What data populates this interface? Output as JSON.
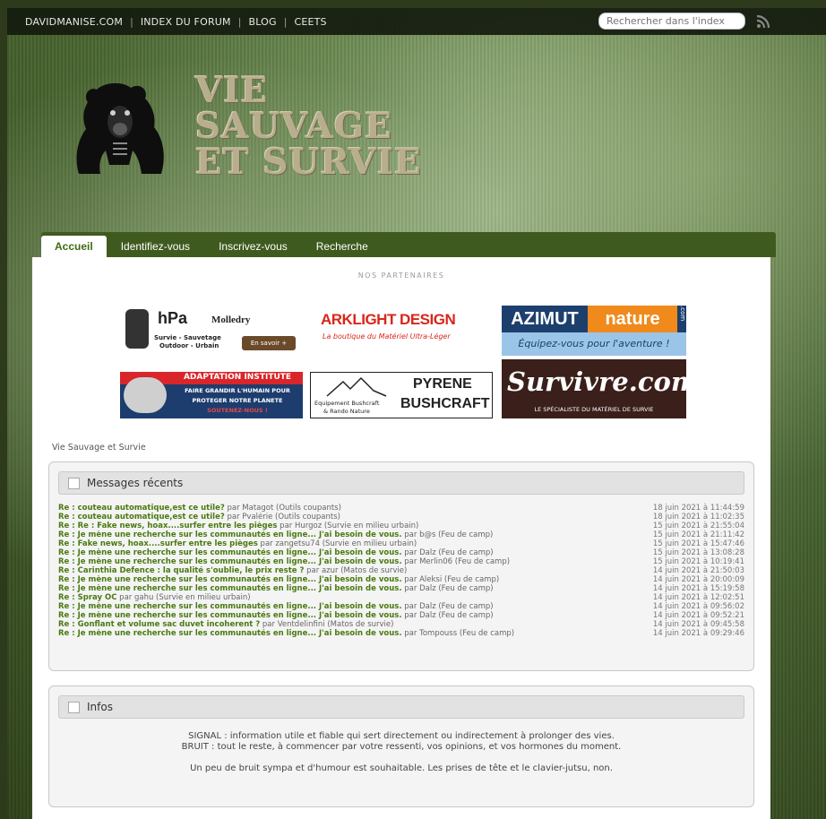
{
  "topbar": {
    "links": [
      "DAVIDMANISE.COM",
      "INDEX DU FORUM",
      "BLOG",
      "CEETS"
    ],
    "search_placeholder": "Rechercher dans l'index"
  },
  "logo": {
    "lines": [
      "VIE",
      "SAUVAGE",
      "ET SURVIE"
    ]
  },
  "nav": {
    "tabs": [
      "Accueil",
      "Identifiez-vous",
      "Inscrivez-vous",
      "Recherche"
    ]
  },
  "partners": {
    "title": "NOS PARTENAIRES",
    "hpa": {
      "name": "hPa",
      "brand2": "Molledry",
      "tag": "Survie - Sauvetage",
      "tag2": "Outdoor - Urbain",
      "btn": "En savoir +"
    },
    "arklight": {
      "name": "ARKLIGHT DESIGN",
      "tag": "La boutique du Matériel Ultra-Léger"
    },
    "azimut": {
      "name1": "AZIMUT",
      "name2": "nature",
      "dot": ".com",
      "tag": "Équipez-vous pour l'aventure !"
    },
    "adaptation": {
      "name": "ADAPTATION INSTITUTE",
      "line1": "FAIRE GRANDIR L'HUMAIN POUR",
      "line2": "PROTEGER NOTRE PLANETE",
      "line3": "SOUTENEZ-NOUS !"
    },
    "pyrene": {
      "name1": "PYRENE",
      "name2": "BUSHCRAFT",
      "tag1": "Equipement Bushcraft",
      "tag2": "& Rando Nature"
    },
    "survivre": {
      "name": "Survivre.com",
      "tag": "LE SPÉCIALISTE DU MATÉRIEL DE SURVIE"
    }
  },
  "breadcrumb": "Vie Sauvage et Survie",
  "recent": {
    "title": "Messages récents",
    "items": [
      {
        "title": "Re : couteau automatique,est ce utile?",
        "by": " par Matagot (Outils coupants)",
        "date": "18 juin 2021 à 11:44:59"
      },
      {
        "title": "Re : couteau automatique,est ce utile?",
        "by": " par Pvalérie (Outils coupants)",
        "date": "18 juin 2021 à 11:02:35"
      },
      {
        "title": "Re : Re : Fake news, hoax....surfer entre les pièges",
        "by": " par Hurgoz (Survie en milieu urbain)",
        "date": "15 juin 2021 à 21:55:04"
      },
      {
        "title": "Re : Je mène une recherche sur les communautés en ligne... J'ai besoin de vous.",
        "by": " par b@s (Feu de camp)",
        "date": "15 juin 2021 à 21:11:42"
      },
      {
        "title": "Re : Fake news, hoax....surfer entre les pièges",
        "by": " par zangetsu74 (Survie en milieu urbain)",
        "date": "15 juin 2021 à 15:47:46"
      },
      {
        "title": "Re : Je mène une recherche sur les communautés en ligne... J'ai besoin de vous.",
        "by": " par Dalz (Feu de camp)",
        "date": "15 juin 2021 à 13:08:28"
      },
      {
        "title": "Re : Je mène une recherche sur les communautés en ligne... J'ai besoin de vous.",
        "by": " par Merlin06 (Feu de camp)",
        "date": "15 juin 2021 à 10:19:41"
      },
      {
        "title": "Re : Carinthia Defence : la qualité s'oublie, le prix reste ?",
        "by": " par azur (Matos de survie)",
        "date": "14 juin 2021 à 21:50:03"
      },
      {
        "title": "Re : Je mène une recherche sur les communautés en ligne... J'ai besoin de vous.",
        "by": " par Aleksi (Feu de camp)",
        "date": "14 juin 2021 à 20:00:09"
      },
      {
        "title": "Re : Je mène une recherche sur les communautés en ligne... J'ai besoin de vous.",
        "by": " par Dalz (Feu de camp)",
        "date": "14 juin 2021 à 15:19:58"
      },
      {
        "title": "Re : Spray OC",
        "by": " par gahu (Survie en milieu urbain)",
        "date": "14 juin 2021 à 12:02:51"
      },
      {
        "title": "Re : Je mène une recherche sur les communautés en ligne... J'ai besoin de vous.",
        "by": " par Dalz (Feu de camp)",
        "date": "14 juin 2021 à 09:56:02"
      },
      {
        "title": "Re : Je mène une recherche sur les communautés en ligne... J'ai besoin de vous.",
        "by": " par Dalz (Feu de camp)",
        "date": "14 juin 2021 à 09:52:21"
      },
      {
        "title": "Re : Gonflant et volume sac duvet incoherent ?",
        "by": " par Ventdelinfini (Matos de survie)",
        "date": "14 juin 2021 à 09:45:58"
      },
      {
        "title": "Re : Je mène une recherche sur les communautés en ligne... J'ai besoin de vous.",
        "by": " par Tompouss (Feu de camp)",
        "date": "14 juin 2021 à 09:29:46"
      }
    ]
  },
  "infos": {
    "title": "Infos",
    "line1": "SIGNAL : information utile et fiable qui sert directement ou indirectement à prolonger des vies.",
    "line2": "BRUIT : tout le reste, à commencer par votre ressenti, vos opinions, et vos hormones du moment.",
    "line3": "Un peu de bruit sympa et d'humour est souhaitable.  Les prises de tête et le clavier-jutsu, non."
  },
  "colors": {
    "nav_bg": "#3f5a1e",
    "link_green": "#4a7a10",
    "topbar": "#141a0e"
  }
}
